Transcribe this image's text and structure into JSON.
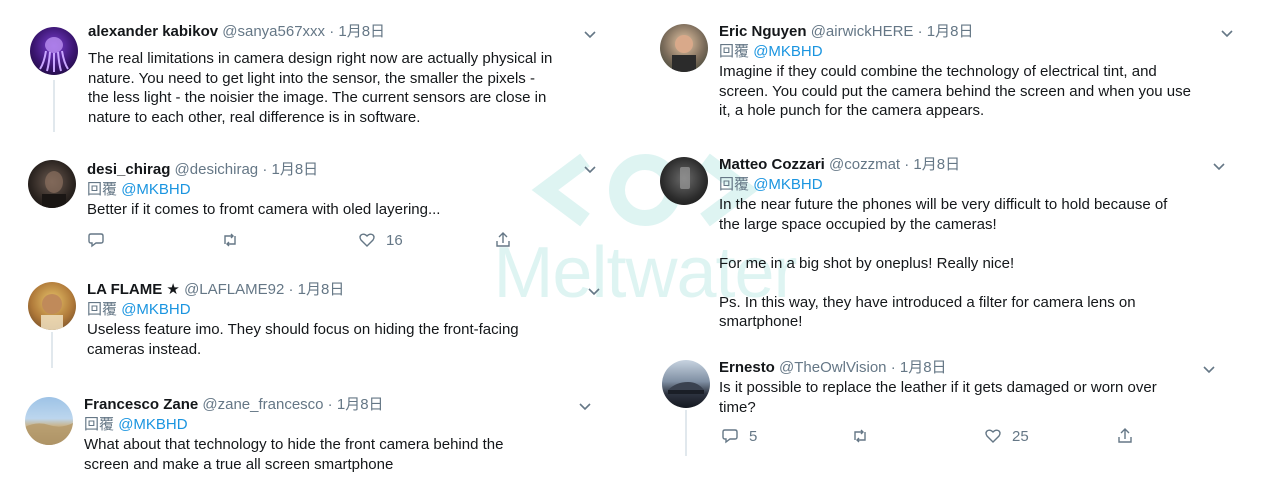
{
  "watermark": "Meltwater",
  "left_tweets": [
    {
      "name": "alexander kabikov",
      "meta": "@sanya567xxx · 1月8日",
      "text": "The real limitations in camera design right now are actually physical in\nnature. You need to get light into the sensor, the smaller the pixels -\nthe less light - the noisier the image. The current sensors are close in\nnature to each other, real difference is in software."
    },
    {
      "name": "desi_chirag",
      "meta": "@desichirag · 1月8日",
      "reply_prefix": "回覆",
      "reply_handle": "@MKBHD",
      "text": "Better if it comes to fromt camera with oled layering...",
      "likes": "16"
    },
    {
      "name": "LA FLAME ★",
      "meta": "@LAFLAME92 · 1月8日",
      "reply_prefix": "回覆",
      "reply_handle": "@MKBHD",
      "text": "Useless feature imo. They should focus on hiding the front-facing\ncameras instead."
    },
    {
      "name": "Francesco Zane",
      "meta": "@zane_francesco · 1月8日",
      "reply_prefix": "回覆",
      "reply_handle": "@MKBHD",
      "text": "What about that technology to hide the front camera behind the\nscreen and make a true all screen smartphone"
    }
  ],
  "right_tweets": [
    {
      "name": "Eric Nguyen",
      "meta": "@airwickHERE · 1月8日",
      "reply_prefix": "回覆",
      "reply_handle": "@MKBHD",
      "text": "Imagine if they could combine the technology of electrical tint, and\nscreen. You could put the camera behind the screen and when you use\nit, a hole punch for the camera appears."
    },
    {
      "name": "Matteo Cozzari",
      "meta": "@cozzmat · 1月8日",
      "reply_prefix": "回覆",
      "reply_handle": "@MKBHD",
      "text": "In the near future the phones will be very difficult to hold because of\nthe large space occupied by the cameras!\n\nFor me in a big shot by oneplus! Really nice!\n\nPs. In this way, they have introduced a filter for camera lens on\nsmartphone!"
    },
    {
      "name": "Ernesto",
      "meta": "@TheOwlVision · 1月8日",
      "text": "Is it possible to replace the leather if it gets damaged or worn over\ntime?",
      "replies": "5",
      "likes": "25"
    }
  ],
  "colors": {
    "link": "#1b95e0",
    "secondary": "#657786",
    "thread_line": "#e1e8ed",
    "watermark": "#1fb3a8"
  }
}
